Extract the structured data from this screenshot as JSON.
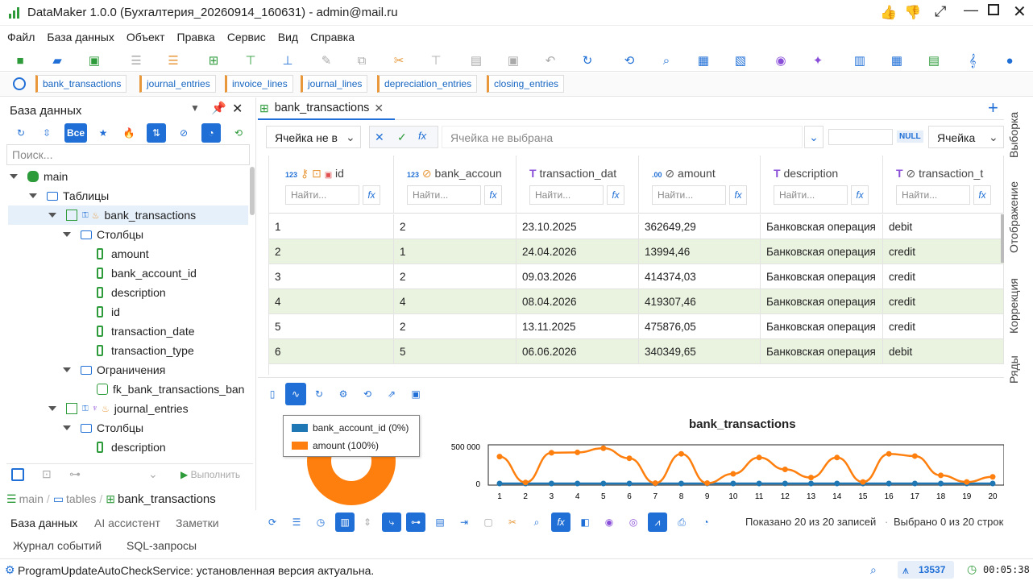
{
  "window": {
    "title": "DataMaker 1.0.0 (Бухгалтерия_20260914_160631) - admin@mail.ru"
  },
  "menu": [
    "Файл",
    "База данных",
    "Объект",
    "Правка",
    "Сервис",
    "Вид",
    "Справка"
  ],
  "table_tabs": [
    "bank_transactions",
    "journal_entries",
    "invoice_lines",
    "journal_lines",
    "depreciation_entries",
    "closing_entries"
  ],
  "left": {
    "header": "База данных",
    "all_label": "Все",
    "search_placeholder": "Поиск...",
    "tree": {
      "main": "main",
      "tables": "Таблицы",
      "t1": "bank_transactions",
      "cols": "Столбцы",
      "c1": "amount",
      "c2": "bank_account_id",
      "c3": "description",
      "c4": "id",
      "c5": "transaction_date",
      "c6": "transaction_type",
      "constraints": "Ограничения",
      "k1": "fk_bank_transactions_ban",
      "t2": "journal_entries",
      "cols2": "Столбцы",
      "c7": "description"
    },
    "execute": "Выполнить",
    "breadcrumb": {
      "a": "main",
      "b": "tables",
      "c": "bank_transactions"
    },
    "bottom_tabs": [
      "База данных",
      "AI ассистент",
      "Заметки",
      "Журнал событий",
      "SQL-запросы"
    ]
  },
  "editor": {
    "tab": "bank_transactions",
    "cell_select": "Ячейка не в",
    "cell_placeholder": "Ячейка не выбрана",
    "null_label": "NULL",
    "mode_select": "Ячейка"
  },
  "grid": {
    "columns": [
      {
        "name": "id",
        "find": "Найти..."
      },
      {
        "name": "bank_accoun",
        "find": "Найти..."
      },
      {
        "name": "transaction_dat",
        "find": "Найти..."
      },
      {
        "name": "amount",
        "find": "Найти..."
      },
      {
        "name": "description",
        "find": "Найти..."
      },
      {
        "name": "transaction_t",
        "find": "Найти..."
      }
    ],
    "rows": [
      [
        "1",
        "2",
        "23.10.2025",
        "362649,29",
        "Банковская операция",
        "debit"
      ],
      [
        "2",
        "1",
        "24.04.2026",
        "13994,46",
        "Банковская операция",
        "credit"
      ],
      [
        "3",
        "2",
        "09.03.2026",
        "414374,03",
        "Банковская операция",
        "credit"
      ],
      [
        "4",
        "4",
        "08.04.2026",
        "419307,46",
        "Банковская операция",
        "credit"
      ],
      [
        "5",
        "2",
        "13.11.2025",
        "475876,05",
        "Банковская операция",
        "credit"
      ],
      [
        "6",
        "5",
        "06.06.2026",
        "340349,65",
        "Банковская операция",
        "debit"
      ]
    ]
  },
  "side_tabs": [
    "Выборка",
    "Отображение",
    "Коррекция",
    "Ряды"
  ],
  "chart_data": {
    "type": "line",
    "title": "bank_transactions",
    "categories": [
      "1",
      "2",
      "3",
      "4",
      "5",
      "6",
      "7",
      "8",
      "9",
      "10",
      "11",
      "12",
      "13",
      "14",
      "15",
      "16",
      "17",
      "18",
      "19",
      "20"
    ],
    "ytick_labels": [
      "500 000",
      "0"
    ],
    "ylim": [
      0,
      500000
    ],
    "legend_position": "top-left",
    "series": [
      {
        "name": "bank_account_id (0%)",
        "color": "#1f77b4",
        "values": [
          2,
          1,
          2,
          4,
          2,
          5,
          3,
          1,
          2,
          3,
          4,
          2,
          1,
          3,
          2,
          4,
          5,
          1,
          2,
          3
        ]
      },
      {
        "name": "amount (100%)",
        "color": "#ff7f0e",
        "values": [
          362649,
          13994,
          414374,
          419307,
          475876,
          340349,
          5000,
          400000,
          5000,
          130000,
          350000,
          190000,
          80000,
          350000,
          20000,
          400000,
          370000,
          110000,
          20000,
          90000
        ]
      }
    ]
  },
  "footer": {
    "shown": "Показано 20 из 20 записей",
    "selected": "Выбрано 0 из 20 строк"
  },
  "status": {
    "message": "ProgramUpdateAutoCheckService: установленная версия актуальна.",
    "count": "13537",
    "timer": "00:05:38"
  }
}
